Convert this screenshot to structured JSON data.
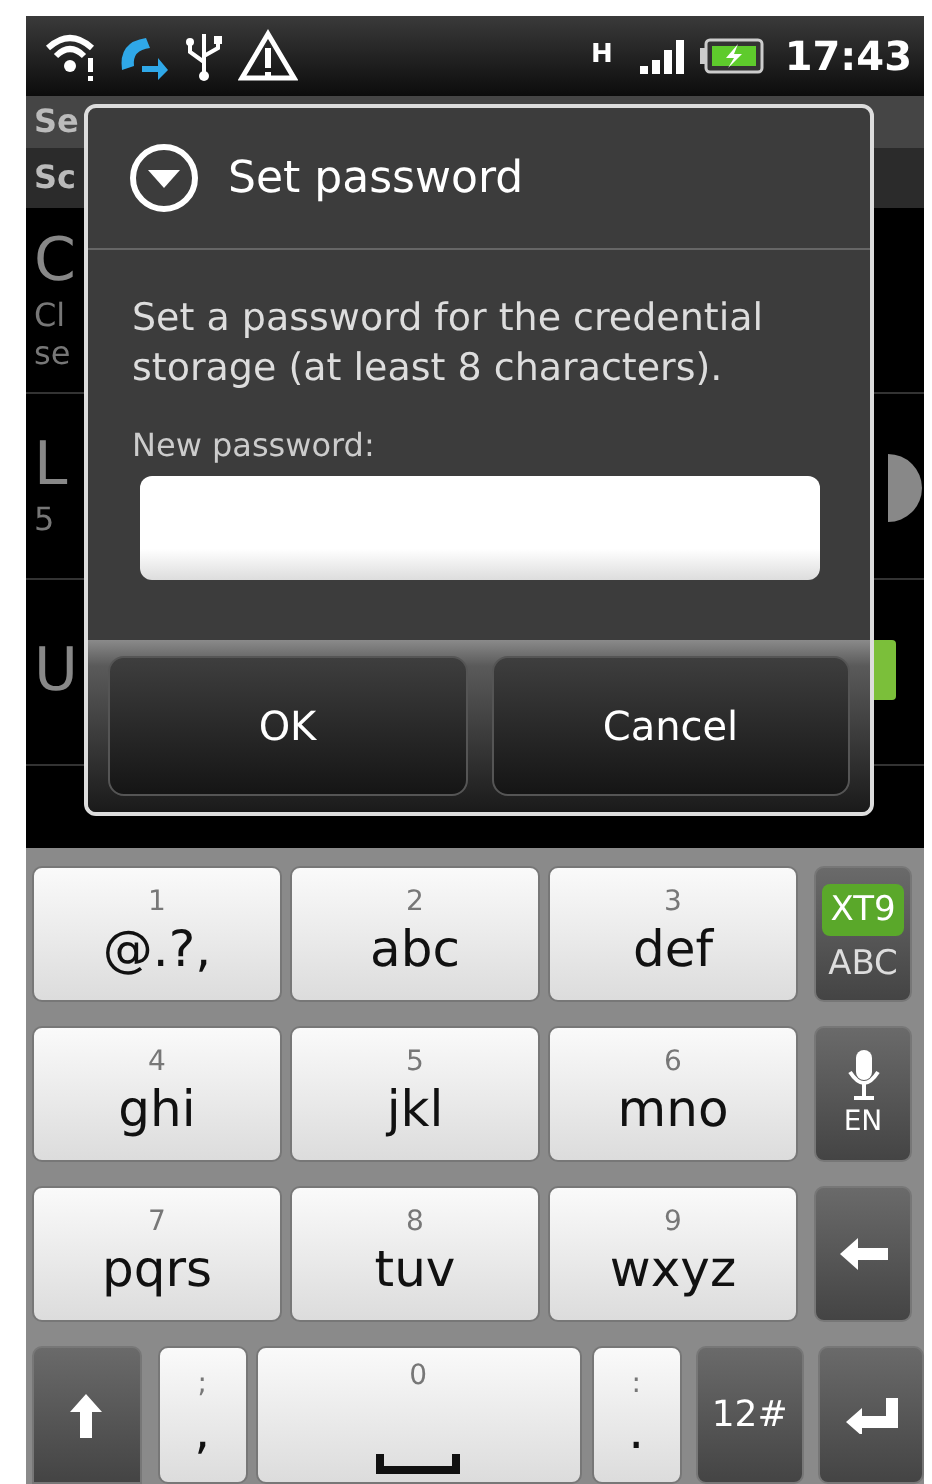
{
  "status_bar": {
    "network_type": "H",
    "time": "17:43"
  },
  "background": {
    "header": "Se",
    "subheader": "Sc",
    "items": [
      {
        "kind": "plain",
        "title": "C",
        "summary": [
          "Cl",
          "se"
        ]
      },
      {
        "kind": "arrow",
        "title": "L",
        "summary": [
          "5"
        ]
      },
      {
        "kind": "check",
        "title": "U"
      }
    ]
  },
  "dialog": {
    "title": "Set password",
    "message": "Set a password for the credential storage (at least 8 characters).",
    "field_label": "New password:",
    "buttons": [
      "OK",
      "Cancel"
    ]
  },
  "keyboard": {
    "rows": [
      [
        {
          "kind": "char",
          "number": "1",
          "letters": "@.?,"
        },
        {
          "kind": "char",
          "number": "2",
          "letters": "abc"
        },
        {
          "kind": "char",
          "number": "3",
          "letters": "def"
        },
        {
          "kind": "mode",
          "top": "XT9",
          "bottom": "ABC"
        }
      ],
      [
        {
          "kind": "char",
          "number": "4",
          "letters": "ghi"
        },
        {
          "kind": "char",
          "number": "5",
          "letters": "jkl"
        },
        {
          "kind": "char",
          "number": "6",
          "letters": "mno"
        },
        {
          "kind": "voice",
          "label": "EN"
        }
      ],
      [
        {
          "kind": "char",
          "number": "7",
          "letters": "pqrs"
        },
        {
          "kind": "char",
          "number": "8",
          "letters": "tuv"
        },
        {
          "kind": "char",
          "number": "9",
          "letters": "wxyz"
        },
        {
          "kind": "backspace"
        }
      ]
    ],
    "bottom_row": [
      {
        "kind": "shift"
      },
      {
        "kind": "small",
        "number": ";",
        "letters": ","
      },
      {
        "kind": "space",
        "number": "0"
      },
      {
        "kind": "small",
        "number": ":",
        "letters": "."
      },
      {
        "kind": "symbols",
        "label": "12#"
      },
      {
        "kind": "enter"
      }
    ]
  }
}
